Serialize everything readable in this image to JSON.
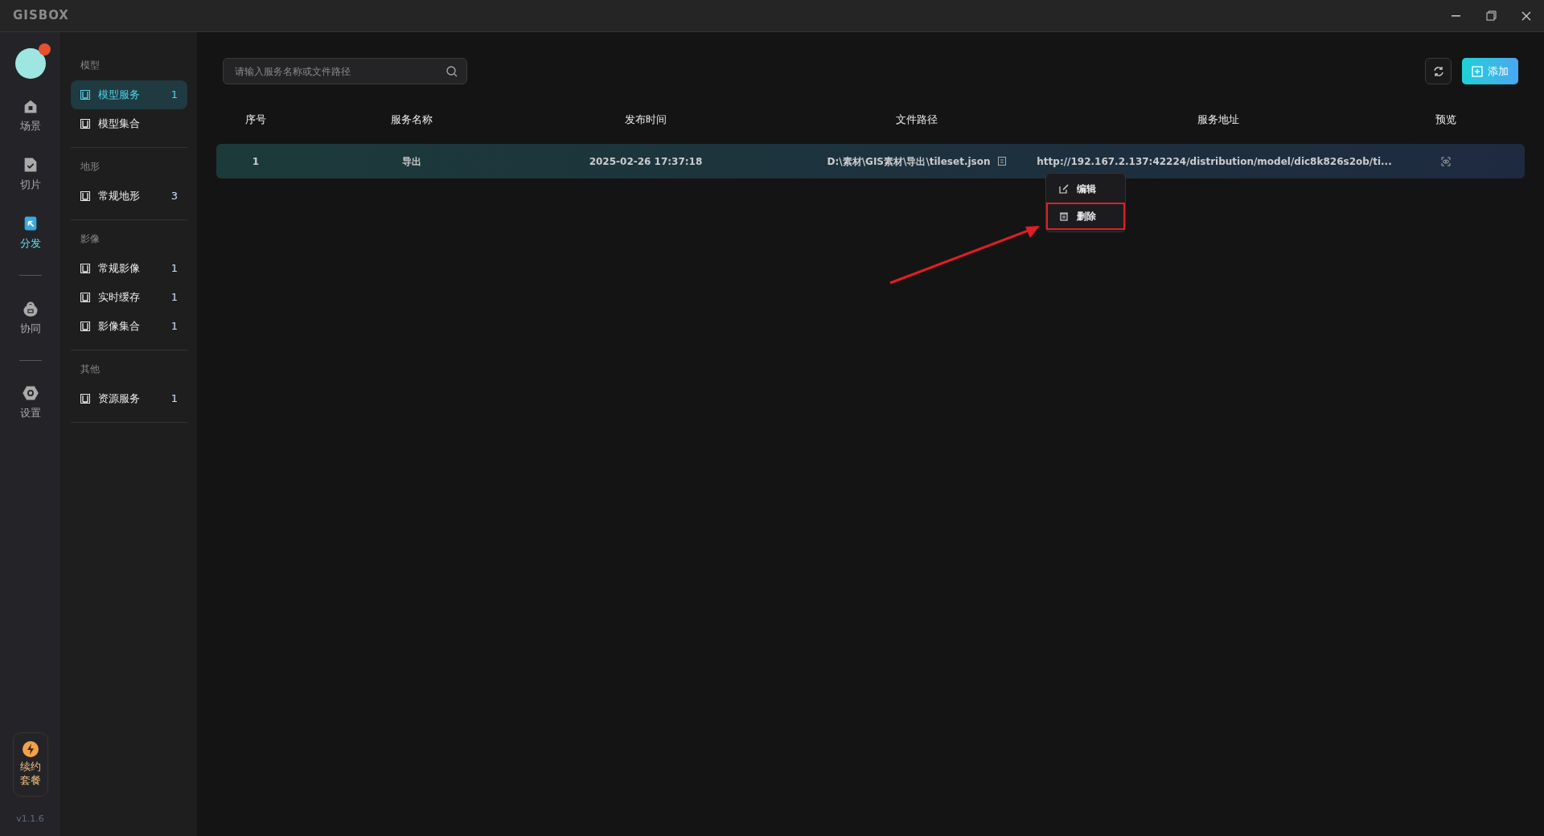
{
  "window": {
    "title": "GISBOX"
  },
  "rail": {
    "items": [
      {
        "label": "场景",
        "selected": false
      },
      {
        "label": "切片",
        "selected": false
      },
      {
        "label": "分发",
        "selected": true
      },
      {
        "label": "协同",
        "selected": false
      },
      {
        "label": "设置",
        "selected": false
      }
    ],
    "renew": [
      "续约",
      "套餐"
    ],
    "version": "v1.1.6"
  },
  "sidebar": {
    "groups": [
      {
        "title": "模型",
        "items": [
          {
            "label": "模型服务",
            "count": "1",
            "selected": true
          },
          {
            "label": "模型集合",
            "selected": false
          }
        ]
      },
      {
        "title": "地形",
        "items": [
          {
            "label": "常规地形",
            "count": "3",
            "selected": false
          }
        ]
      },
      {
        "title": "影像",
        "items": [
          {
            "label": "常规影像",
            "count": "1",
            "selected": false
          },
          {
            "label": "实时缓存",
            "count": "1",
            "selected": false
          },
          {
            "label": "影像集合",
            "count": "1",
            "selected": false
          }
        ]
      },
      {
        "title": "其他",
        "items": [
          {
            "label": "资源服务",
            "count": "1",
            "selected": false
          }
        ]
      }
    ]
  },
  "search": {
    "placeholder": "请输入服务名称或文件路径"
  },
  "add_button": "添加",
  "table": {
    "columns": [
      "序号",
      "服务名称",
      "发布时间",
      "文件路径",
      "服务地址",
      "预览"
    ],
    "rows": [
      {
        "index": "1",
        "name": "导出",
        "time": "2025-02-26 17:37:18",
        "path": "D:\\素材\\GIS素材\\导出\\tileset.json",
        "url": "http://192.167.2.137:42224/distribution/model/dic8k826s2ob/ti...",
        "selected": true
      }
    ]
  },
  "context_menu": {
    "items": [
      {
        "label": "编辑",
        "kind": "edit",
        "highlighted": false
      },
      {
        "label": "删除",
        "kind": "delete",
        "highlighted": true
      }
    ]
  }
}
